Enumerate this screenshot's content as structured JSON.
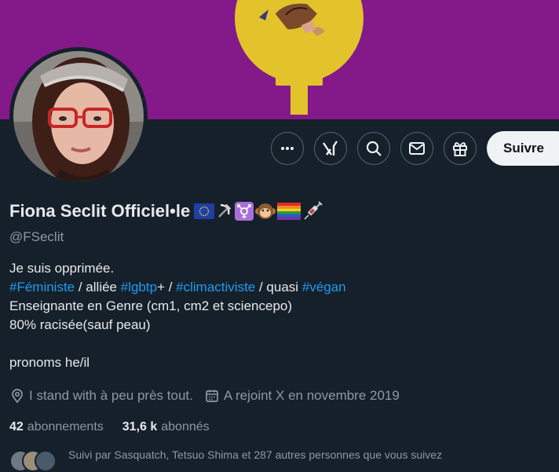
{
  "profile": {
    "display_name": "Fiona Seclit Officiel•le",
    "name_emojis": [
      "eu-flag",
      "hammer-sickle",
      "transgender-symbol",
      "monkey",
      "rainbow-flag",
      "syringe"
    ],
    "handle": "@FSeclit",
    "bio_line1": "Je suis opprimée.",
    "bio_tags": {
      "feministe": "#Féministe",
      "sep1": " / alliée ",
      "lgbtp": "#lgbtp",
      "sep2": "+ / ",
      "climactiviste": "#climactiviste",
      "sep3": " / quasi ",
      "vegan": "#végan"
    },
    "bio_line3": "Enseignante en Genre (cm1, cm2 et sciencepo)",
    "bio_line4": "80% racisée(sauf peau)",
    "bio_line6": "pronoms he/il",
    "location": "I stand with à peu près tout.",
    "joined": "A rejoint X en novembre 2019",
    "following_count": "42",
    "following_label": "abonnements",
    "followers_count": "31,6 k",
    "followers_label": "abonnés",
    "followed_by": "Suivi par Sasquatch, Tetsuo Shima et 287 autres personnes que vous suivez"
  },
  "actions": {
    "more_icon": "more-icon",
    "grok_icon": "grok-icon",
    "search_icon": "search-icon",
    "message_icon": "message-icon",
    "gift_icon": "gift-icon",
    "follow_label": "Suivre"
  },
  "colors": {
    "background": "#15202b",
    "banner": "#84198a",
    "banner_symbol": "#e2c32c",
    "link": "#1d9bf0",
    "muted": "#8b98a5",
    "text": "#e7e9ea"
  }
}
